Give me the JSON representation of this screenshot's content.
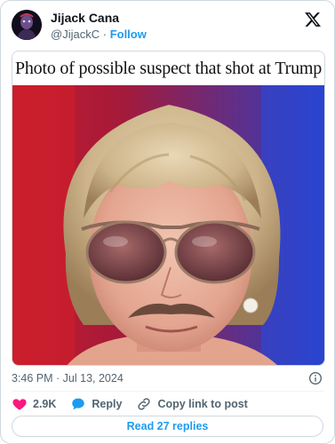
{
  "author": {
    "display_name": "Jijack Cana",
    "handle": "@JijackC",
    "separator": "·",
    "follow_label": "Follow"
  },
  "media": {
    "headline": "Photo of possible suspect that shot at Trump"
  },
  "meta": {
    "timestamp": "3:46 PM · Jul 13, 2024"
  },
  "actions": {
    "like_count": "2.9K",
    "reply_label": "Reply",
    "copy_link_label": "Copy link to post"
  },
  "replies": {
    "label": "Read 27 replies"
  },
  "icons": {
    "brand": "x-logo-icon",
    "like": "heart-icon",
    "reply": "speech-bubble-icon",
    "copy": "link-icon",
    "info": "info-icon"
  },
  "colors": {
    "accent": "#1d9bf0",
    "like": "#f91880",
    "text": "#0f1419",
    "muted": "#536471",
    "border": "#cfd9de"
  }
}
